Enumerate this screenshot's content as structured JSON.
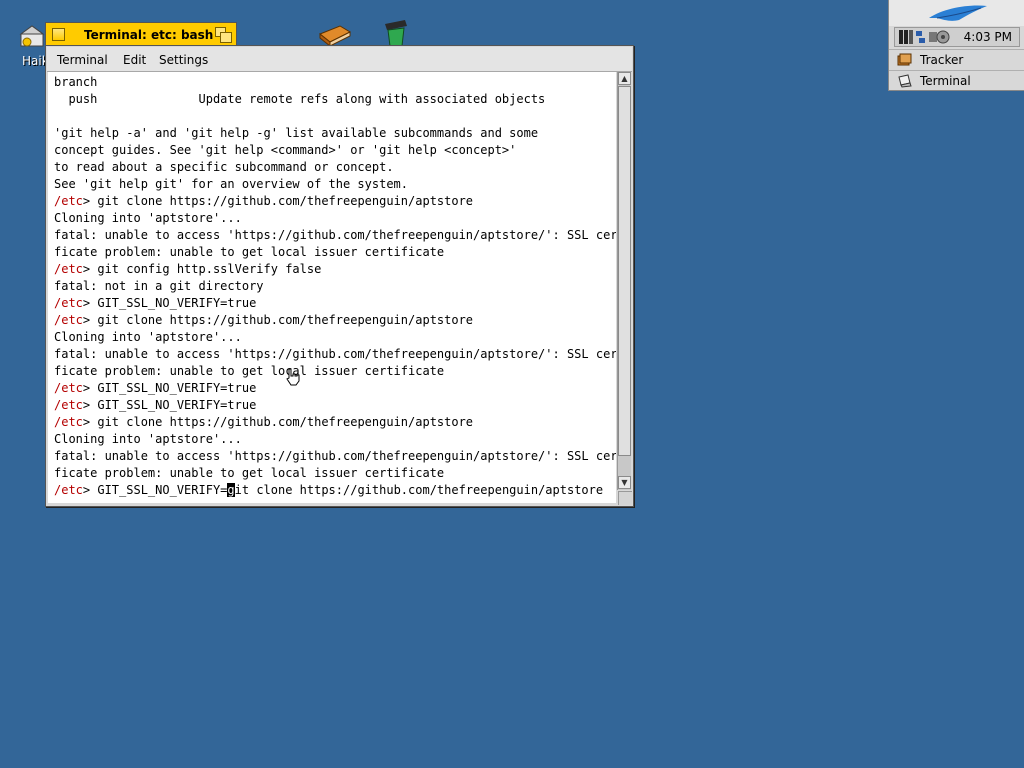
{
  "desktop": {
    "home_icon_label": "Haiku"
  },
  "window": {
    "title": "Terminal: etc: bash",
    "menu": [
      "Terminal",
      "Edit",
      "Settings"
    ]
  },
  "terminal": {
    "lines": [
      {
        "prompt": "",
        "text": "branch"
      },
      {
        "prompt": "",
        "text": "  push              Update remote refs along with associated objects"
      },
      {
        "prompt": "",
        "text": ""
      },
      {
        "prompt": "",
        "text": "'git help -a' and 'git help -g' list available subcommands and some"
      },
      {
        "prompt": "",
        "text": "concept guides. See 'git help <command>' or 'git help <concept>'"
      },
      {
        "prompt": "",
        "text": "to read about a specific subcommand or concept."
      },
      {
        "prompt": "",
        "text": "See 'git help git' for an overview of the system."
      },
      {
        "prompt": "/etc",
        "text": "> git clone https://github.com/thefreepenguin/aptstore"
      },
      {
        "prompt": "",
        "text": "Cloning into 'aptstore'..."
      },
      {
        "prompt": "",
        "text": "fatal: unable to access 'https://github.com/thefreepenguin/aptstore/': SSL certi"
      },
      {
        "prompt": "",
        "text": "ficate problem: unable to get local issuer certificate"
      },
      {
        "prompt": "/etc",
        "text": "> git config http.sslVerify false"
      },
      {
        "prompt": "",
        "text": "fatal: not in a git directory"
      },
      {
        "prompt": "/etc",
        "text": "> GIT_SSL_NO_VERIFY=true"
      },
      {
        "prompt": "/etc",
        "text": "> git clone https://github.com/thefreepenguin/aptstore"
      },
      {
        "prompt": "",
        "text": "Cloning into 'aptstore'..."
      },
      {
        "prompt": "",
        "text": "fatal: unable to access 'https://github.com/thefreepenguin/aptstore/': SSL certi"
      },
      {
        "prompt": "",
        "text": "ficate problem: unable to get local issuer certificate"
      },
      {
        "prompt": "/etc",
        "text": "> GIT_SSL_NO_VERIFY=true"
      },
      {
        "prompt": "/etc",
        "text": "> GIT_SSL_NO_VERIFY=true"
      },
      {
        "prompt": "/etc",
        "text": "> git clone https://github.com/thefreepenguin/aptstore"
      },
      {
        "prompt": "",
        "text": "Cloning into 'aptstore'..."
      },
      {
        "prompt": "",
        "text": "fatal: unable to access 'https://github.com/thefreepenguin/aptstore/': SSL certi"
      },
      {
        "prompt": "",
        "text": "ficate problem: unable to get local issuer certificate"
      }
    ],
    "current_line": {
      "prompt": "/etc",
      "before_cursor": "> GIT_SSL_NO_VERIFY=",
      "cursor_char": "g",
      "after_cursor": "it clone https://github.com/thefreepenguin/aptstore"
    }
  },
  "deskbar": {
    "clock": "4:03 PM",
    "apps": [
      {
        "label": "Tracker",
        "icon": "tracker-icon"
      },
      {
        "label": "Terminal",
        "icon": "terminal-icon"
      }
    ]
  },
  "colors": {
    "desktop": "#336698",
    "window_tab": "#ffcb00",
    "prompt": "#b40000"
  }
}
